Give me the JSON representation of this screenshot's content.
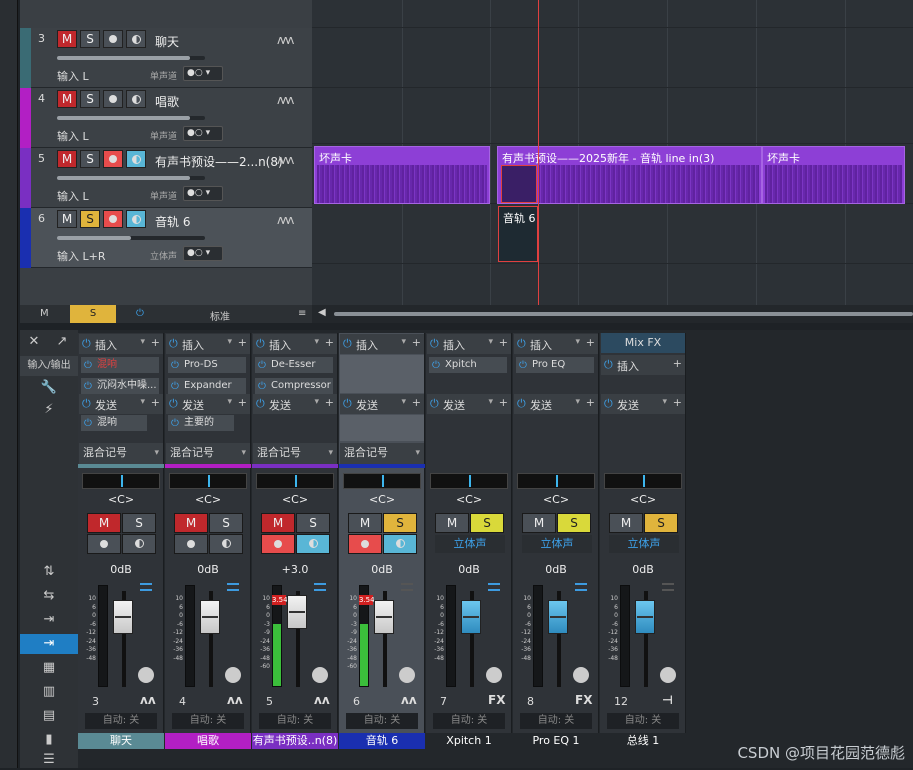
{
  "tracks": [
    {
      "num": "3",
      "name": "聊天",
      "input": "输入 L",
      "mode": "单声道",
      "color": "#3a6b74",
      "solo": false,
      "rec": false,
      "mon": false,
      "fader": 0.9
    },
    {
      "num": "4",
      "name": "唱歌",
      "input": "输入 L",
      "mode": "单声道",
      "color": "#b21fc4",
      "solo": false,
      "rec": false,
      "mon": false,
      "fader": 0.9
    },
    {
      "num": "5",
      "name": "有声书预设——2...n(8)",
      "input": "输入 L",
      "mode": "单声道",
      "color": "#7a2fc2",
      "solo": false,
      "rec": true,
      "mon": true,
      "fader": 0.9
    },
    {
      "num": "6",
      "name": "音轨 6",
      "input": "输入 L+R",
      "mode": "立体声",
      "color": "#1a2fb0",
      "solo": true,
      "rec": true,
      "mon": true,
      "fader": 0.5
    }
  ],
  "track_btn": {
    "m": "M",
    "s": "S"
  },
  "trackbar": {
    "m": "M",
    "s": "S",
    "view": "标准"
  },
  "clips": [
    {
      "label": "坏声卡"
    },
    {
      "label": "有声书预设——2025新年 - 音轨 line in(3)"
    },
    {
      "label": "坏声卡"
    },
    {
      "label": "音轨 6"
    }
  ],
  "console_tools": {
    "io": "输入/输出"
  },
  "strips": [
    {
      "ins_label": "插入",
      "inserts": [
        "混响",
        "沉闷水中噪..."
      ],
      "send_label": "发送",
      "sends": [
        "混响"
      ],
      "mixrec": "混合记号",
      "pan": "<C>",
      "m": "M",
      "s": "S",
      "db": "0dB",
      "num": "3",
      "name": "聊天",
      "color": "#5a8a94",
      "auto": "自动: 关",
      "icon": "wave",
      "solo": false
    },
    {
      "ins_label": "插入",
      "inserts": [
        "Pro-DS",
        "Expander"
      ],
      "send_label": "发送",
      "sends": [
        "主要的"
      ],
      "mixrec": "混合记号",
      "pan": "<C>",
      "m": "M",
      "s": "S",
      "db": "0dB",
      "num": "4",
      "name": "唱歌",
      "color": "#b21fc4",
      "auto": "自动: 关",
      "icon": "wave",
      "solo": false
    },
    {
      "ins_label": "插入",
      "inserts": [
        "De-Esser",
        "Compressor"
      ],
      "send_label": "发送",
      "sends": [],
      "mixrec": "混合记号",
      "pan": "<C>",
      "m": "M",
      "s": "S",
      "db": "+3.0",
      "num": "5",
      "name": "有声书预设..n(8)",
      "color": "#7a2fc2",
      "auto": "自动: 关",
      "icon": "wave",
      "peak": "3.54",
      "solo": false
    },
    {
      "ins_label": "插入",
      "inserts": [],
      "send_label": "发送",
      "sends": [],
      "mixrec": "混合记号",
      "pan": "<C>",
      "m": "M",
      "s": "S",
      "db": "0dB",
      "num": "6",
      "name": "音轨 6",
      "color": "#1a2fb0",
      "auto": "自动: 关",
      "icon": "wave",
      "peak": "3.54",
      "solo": true
    },
    {
      "ins_label": "插入",
      "inserts": [
        "Xpitch"
      ],
      "send_label": "发送",
      "sends": [],
      "pan": "<C>",
      "m": "M",
      "s": "S",
      "stereo": "立体声",
      "db": "0dB",
      "num": "7",
      "name": "Xpitch 1",
      "color": "#23272b",
      "auto": "自动: 关",
      "icon": "FX",
      "solo": true
    },
    {
      "ins_label": "插入",
      "inserts": [
        "Pro EQ"
      ],
      "send_label": "发送",
      "sends": [],
      "pan": "<C>",
      "m": "M",
      "s": "S",
      "stereo": "立体声",
      "db": "0dB",
      "num": "8",
      "name": "Pro EQ 1",
      "color": "#23272b",
      "auto": "自动: 关",
      "icon": "FX",
      "solo": true
    },
    {
      "ins_label": "插入",
      "inserts": [],
      "send_label": "发送",
      "sends": [],
      "pan": "<C>",
      "m": "M",
      "s": "S",
      "stereo": "立体声",
      "db": "0dB",
      "num": "12",
      "name": "总线 1",
      "color": "#23272b",
      "auto": "自动: 关",
      "icon": "bus",
      "header": "Mix FX",
      "solo": true
    }
  ],
  "scale": [
    "10",
    "6",
    "0",
    "-6",
    "-12",
    "-24",
    "-36",
    "-48"
  ],
  "scale_ext": [
    "10",
    "6",
    "0",
    "-3",
    "-9",
    "-24",
    "-36",
    "-48",
    "-60"
  ],
  "watermark": "CSDN @项目花园范德彪"
}
